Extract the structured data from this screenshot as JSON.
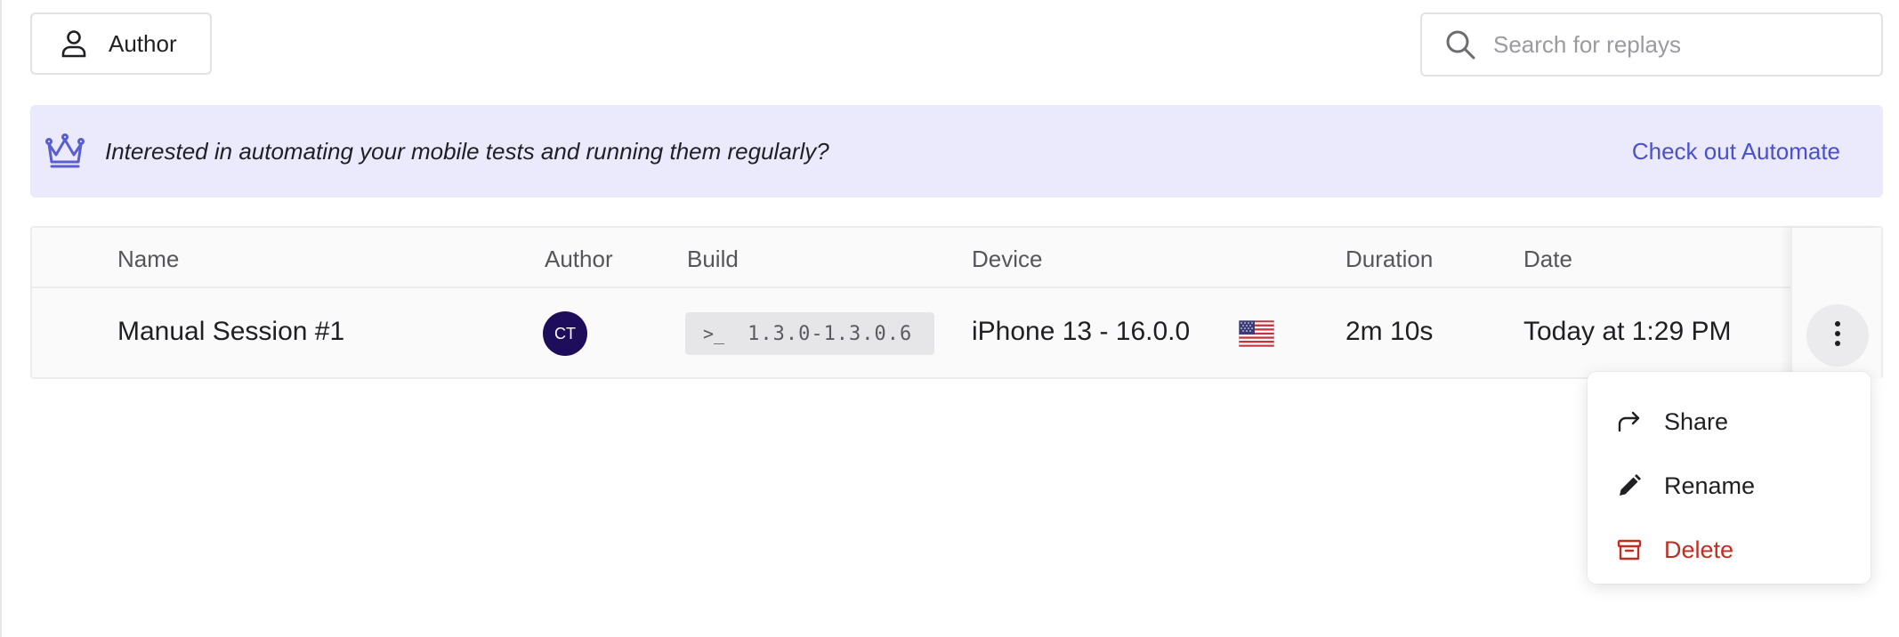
{
  "filters": {
    "author_label": "Author"
  },
  "search": {
    "placeholder": "Search for replays"
  },
  "banner": {
    "message": "Interested in automating your mobile tests and running them regularly?",
    "cta": "Check out Automate"
  },
  "table": {
    "columns": [
      "Name",
      "Author",
      "Build",
      "Device",
      "Duration",
      "Date"
    ],
    "rows": [
      {
        "name": "Manual Session #1",
        "author_initials": "CT",
        "build_prompt": ">_",
        "build": "1.3.0-1.3.0.6",
        "device": "iPhone 13 - 16.0.0",
        "region_flag": "us-flag-icon",
        "duration": "2m 10s",
        "date": "Today at 1:29 PM"
      }
    ]
  },
  "menu": {
    "items": [
      {
        "label": "Share",
        "icon": "share-icon"
      },
      {
        "label": "Rename",
        "icon": "pencil-icon"
      },
      {
        "label": "Delete",
        "icon": "archive-icon"
      }
    ]
  },
  "colors": {
    "accent": "#4b50c9",
    "banner_bg": "#ebeafd",
    "avatar_bg": "#1e0d5a",
    "danger": "#bf2e23"
  }
}
